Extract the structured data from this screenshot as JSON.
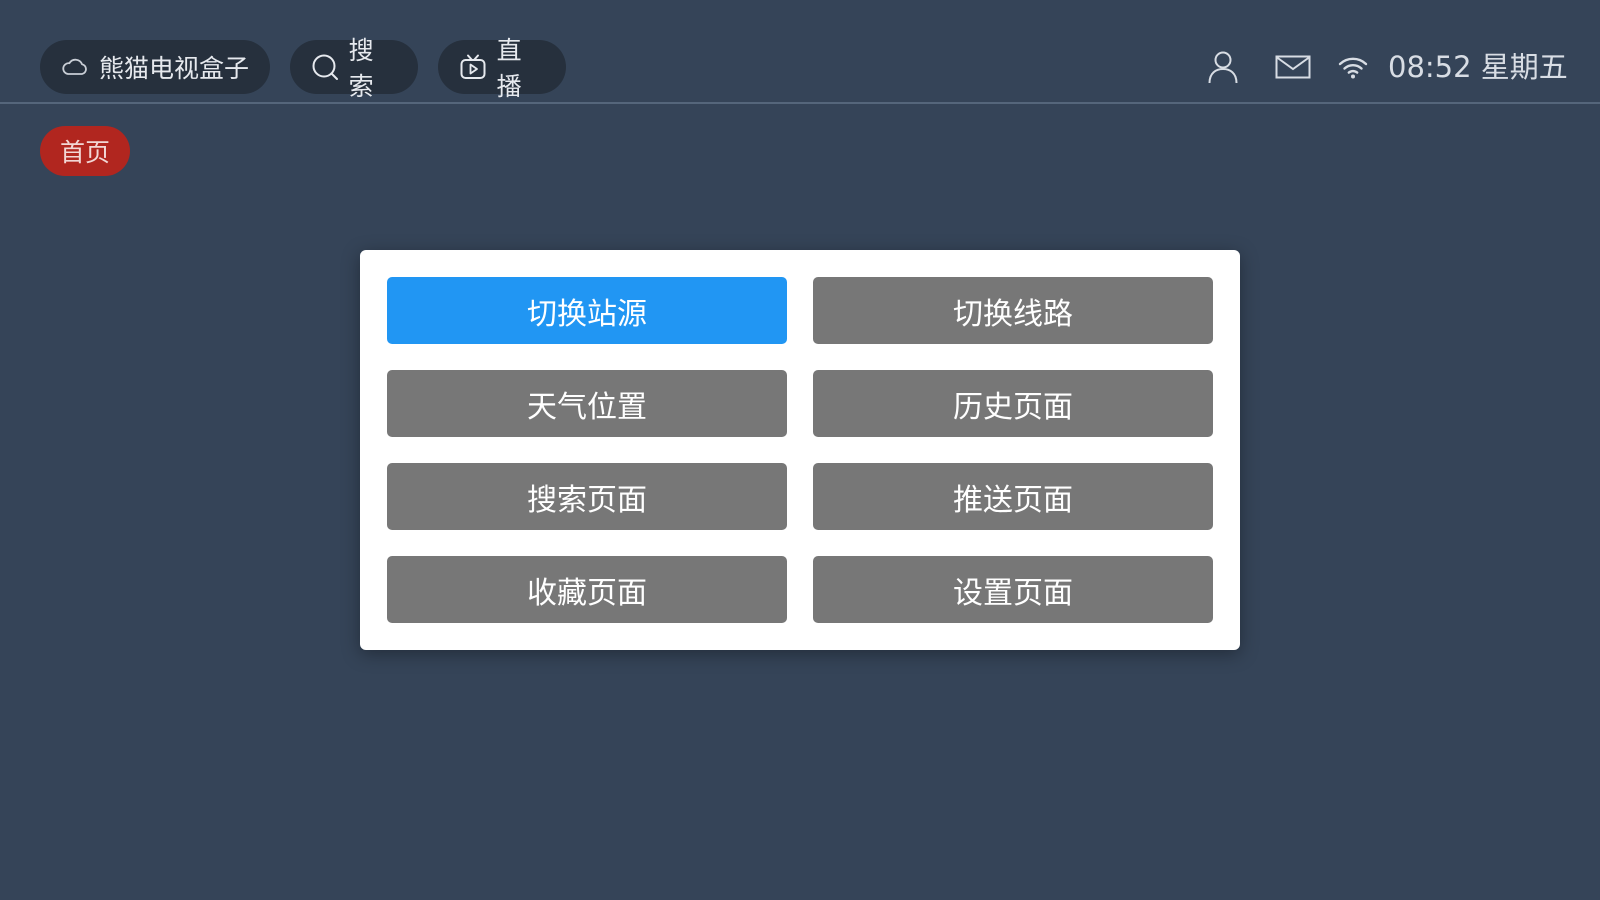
{
  "header": {
    "brand_label": "熊猫电视盒子",
    "brand_icon": "cloud-icon",
    "search_label": "搜索",
    "search_icon": "search-icon",
    "live_label": "直播",
    "live_icon": "tv-play-icon",
    "status_icons": [
      "user-icon",
      "mail-icon",
      "wifi-icon"
    ],
    "clock": "08:52 星期五"
  },
  "nav": {
    "home_tab": "首页",
    "home_tab_color": "#b1261f"
  },
  "dialog": {
    "focused_index": 0,
    "focus_color": "#2196f3",
    "button_color": "#777777",
    "buttons": [
      {
        "label": "切换站源"
      },
      {
        "label": "切换线路"
      },
      {
        "label": "天气位置"
      },
      {
        "label": "历史页面"
      },
      {
        "label": "搜索页面"
      },
      {
        "label": "推送页面"
      },
      {
        "label": "收藏页面"
      },
      {
        "label": "设置页面"
      }
    ]
  },
  "colors": {
    "background": "#354458",
    "pill": "#26303d"
  }
}
